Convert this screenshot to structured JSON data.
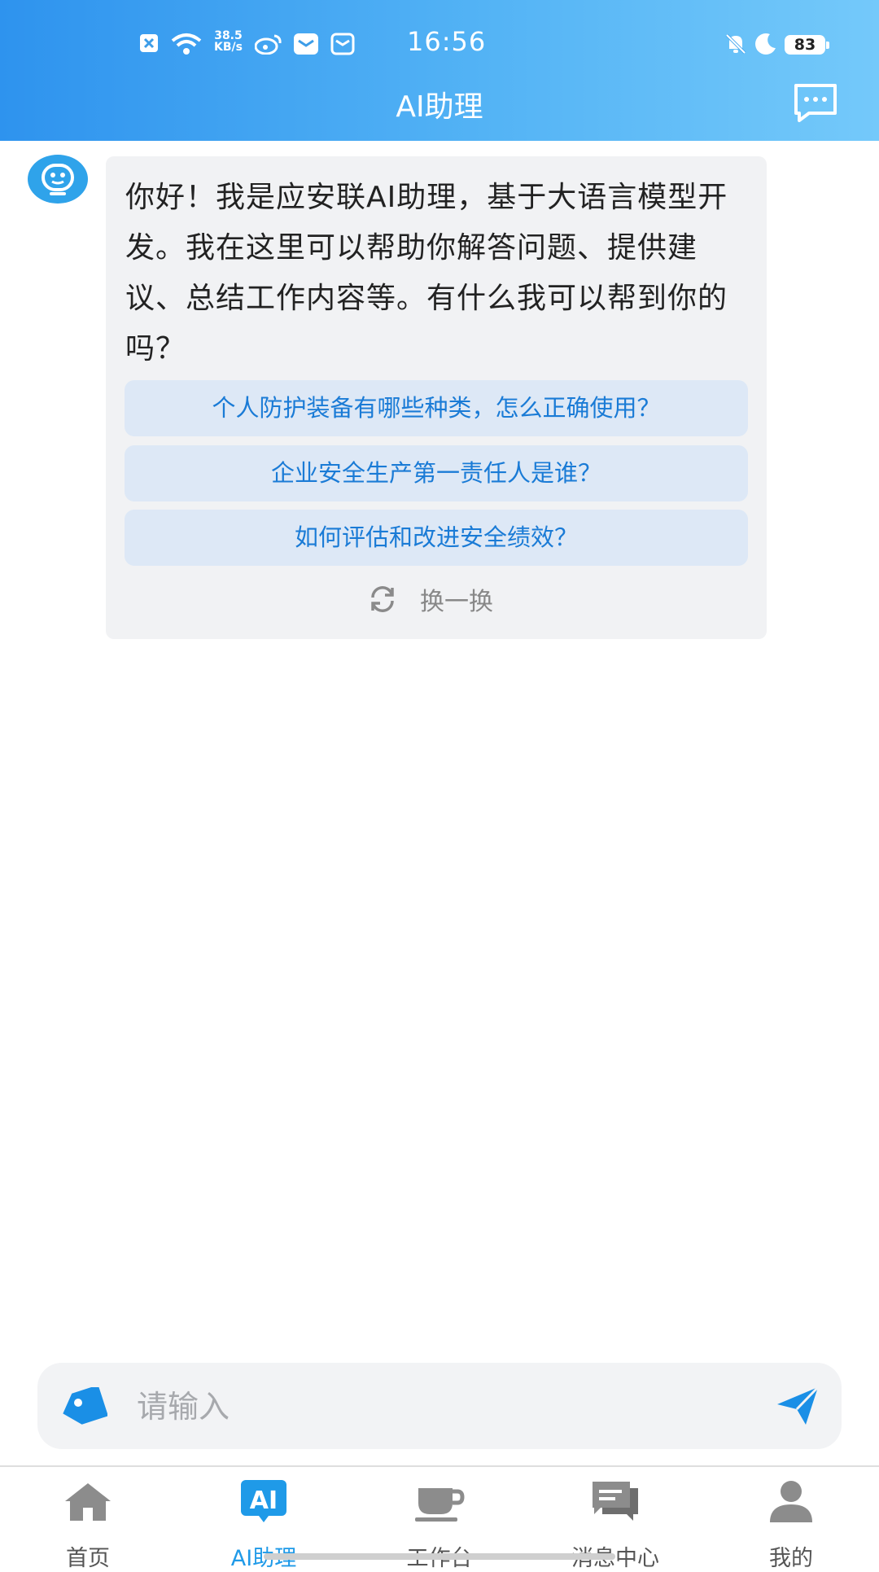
{
  "status_bar": {
    "time": "16:56",
    "net_speed_value": "38.5",
    "net_speed_unit": "KB/s",
    "battery": "83",
    "icons": [
      "notification-x-icon",
      "wifi-icon",
      "weibo-icon",
      "mail-app-icon",
      "email-icon",
      "mute-bell-icon",
      "moon-icon",
      "battery-icon"
    ]
  },
  "header": {
    "title": "AI助理",
    "right_icon": "message-dots-icon"
  },
  "chat": {
    "greeting": "你好！我是应安联AI助理，基于大语言模型开发。我在这里可以帮助你解答问题、提供建议、总结工作内容等。有什么我可以帮到你的吗？",
    "suggestions": [
      "个人防护装备有哪些种类，怎么正确使用？",
      "企业安全生产第一责任人是谁？",
      "如何评估和改进安全绩效？"
    ],
    "refresh_label": "换一换"
  },
  "input": {
    "placeholder": "请输入"
  },
  "tabbar": {
    "active": "AI助理",
    "active_color": "#1f9ae8",
    "items": [
      {
        "label": "首页",
        "icon": "home-icon"
      },
      {
        "label": "AI助理",
        "icon": "ai-icon"
      },
      {
        "label": "工作台",
        "icon": "coffee-cup-icon"
      },
      {
        "label": "消息中心",
        "icon": "chat-bubbles-icon"
      },
      {
        "label": "我的",
        "icon": "user-icon"
      }
    ]
  }
}
